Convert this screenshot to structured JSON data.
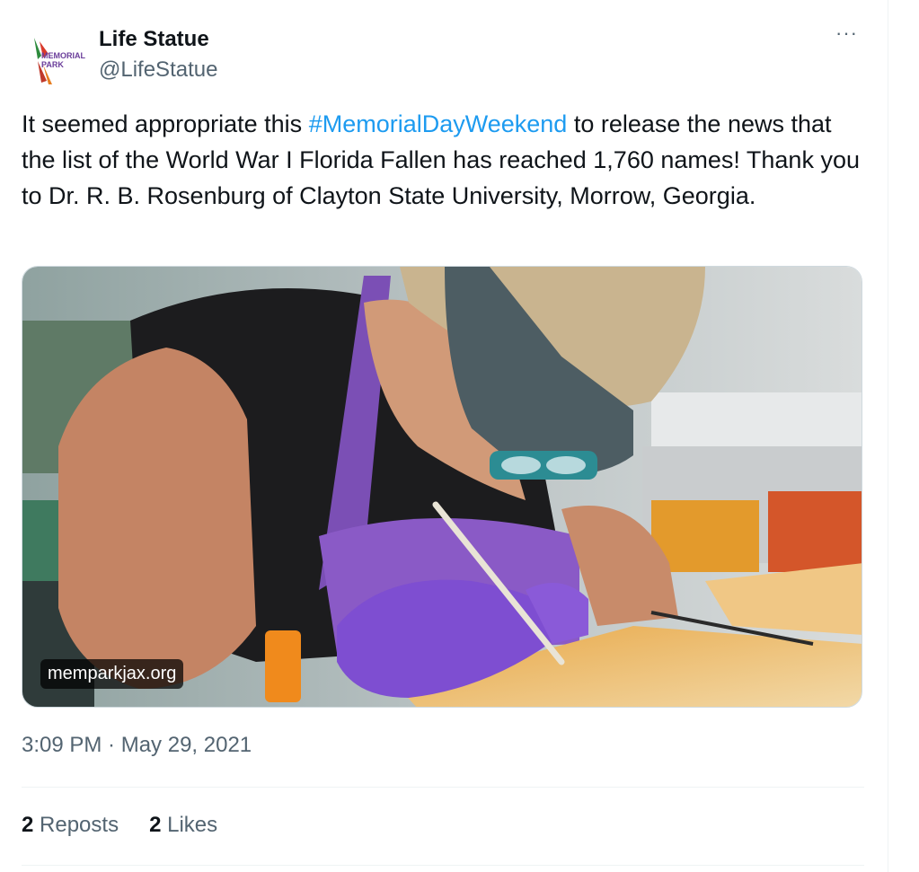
{
  "author": {
    "name": "Life Statue",
    "handle": "@LifeStatue",
    "avatar_icon": "memorial-park-logo-icon",
    "avatar_text_line1": "MEMORIAL",
    "avatar_text_line2": "PARK"
  },
  "more_label": "···",
  "tweet": {
    "text_before": "It seemed appropriate this ",
    "hashtag": "#MemorialDayWeekend",
    "text_after": "  to release the news that the list of the World War I Florida Fallen has reached 1,760 names! Thank you to Dr. R. B. Rosenburg of Clayton State University, Morrow, Georgia."
  },
  "media": {
    "source_badge": "memparkjax.org"
  },
  "timestamp": "3:09 PM · May 29, 2021",
  "stats": {
    "reposts_count": "2",
    "reposts_label": "Reposts",
    "likes_count": "2",
    "likes_label": "Likes"
  },
  "colors": {
    "link": "#1d9bf0",
    "secondary_text": "#536471",
    "primary_text": "#0f1419"
  }
}
